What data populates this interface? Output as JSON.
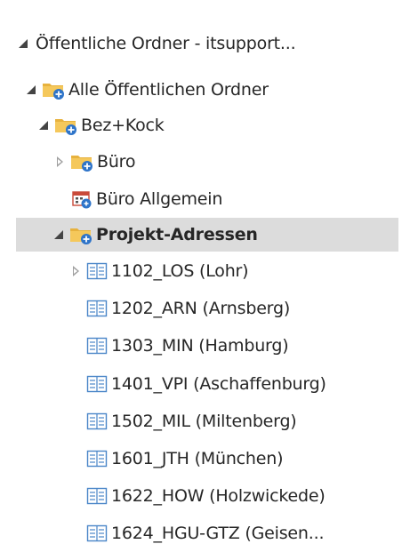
{
  "tree": {
    "root": {
      "label": "Öffentliche Ordner - itsupport..."
    },
    "all_folders": {
      "label": "Alle Öffentlichen Ordner"
    },
    "bez_kock": {
      "label": "Bez+Kock"
    },
    "buero": {
      "label": "Büro"
    },
    "buero_allgemein": {
      "label": "Büro Allgemein"
    },
    "projekt_adressen": {
      "label": "Projekt-Adressen"
    },
    "contacts": [
      {
        "label": "1102_LOS (Lohr)"
      },
      {
        "label": "1202_ARN (Arnsberg)"
      },
      {
        "label": "1303_MIN (Hamburg)"
      },
      {
        "label": "1401_VPI (Aschaffenburg)"
      },
      {
        "label": "1502_MIL (Miltenberg)"
      },
      {
        "label": "1601_JTH (München)"
      },
      {
        "label": "1622_HOW (Holzwickede)"
      },
      {
        "label": "1624_HGU-GTZ  (Geisen..."
      }
    ]
  },
  "icons": {
    "folder": "public-folder-icon",
    "calendar": "calendar-icon",
    "contacts": "contacts-icon"
  },
  "colors": {
    "selection": "#dcdcdc",
    "folder": "#f0c24a",
    "accent": "#2e74c9"
  }
}
